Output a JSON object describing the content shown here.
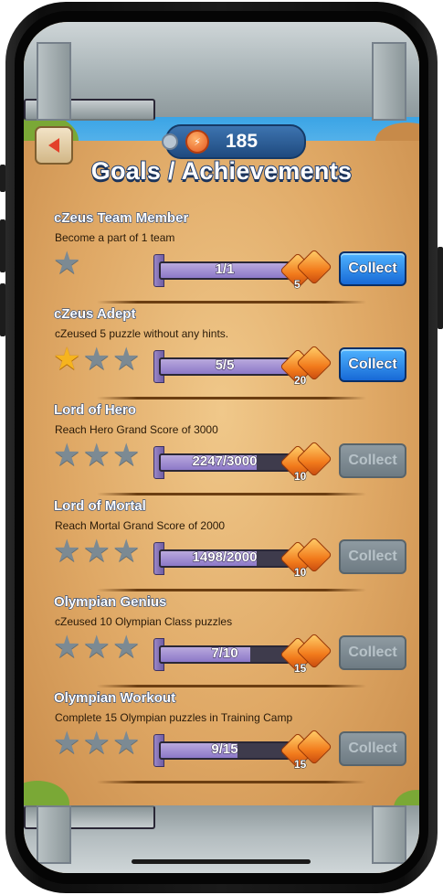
{
  "header": {
    "coin_count": "185",
    "title": "Goals / Achievements"
  },
  "achievements": [
    {
      "name": "cZeus Team Member",
      "description": "Become a part of 1 team",
      "stars_total": 1,
      "stars_earned": 0,
      "progress_text": "1/1",
      "progress": 1.0,
      "reward": "5",
      "collect_label": "Collect",
      "collect_enabled": true
    },
    {
      "name": "cZeus Adept",
      "description": "cZeused 5 puzzle without any hints.",
      "stars_total": 3,
      "stars_earned": 1,
      "progress_text": "5/5",
      "progress": 1.0,
      "reward": "20",
      "collect_label": "Collect",
      "collect_enabled": true
    },
    {
      "name": "Lord of Hero",
      "description": "Reach Hero Grand Score of 3000",
      "stars_total": 3,
      "stars_earned": 0,
      "progress_text": "2247/3000",
      "progress": 0.749,
      "reward": "10",
      "collect_label": "Collect",
      "collect_enabled": false
    },
    {
      "name": "Lord of Mortal",
      "description": "Reach Mortal Grand Score of 2000",
      "stars_total": 3,
      "stars_earned": 0,
      "progress_text": "1498/2000",
      "progress": 0.749,
      "reward": "10",
      "collect_label": "Collect",
      "collect_enabled": false
    },
    {
      "name": "Olympian Genius",
      "description": "cZeused 10 Olympian Class puzzles",
      "stars_total": 3,
      "stars_earned": 0,
      "progress_text": "7/10",
      "progress": 0.7,
      "reward": "15",
      "collect_label": "Collect",
      "collect_enabled": false
    },
    {
      "name": "Olympian Workout",
      "description": "Complete 15 Olympian puzzles in Training Camp",
      "stars_total": 3,
      "stars_earned": 0,
      "progress_text": "9/15",
      "progress": 0.6,
      "reward": "15",
      "collect_label": "Collect",
      "collect_enabled": false
    }
  ],
  "colors": {
    "collect_active": "#1769d6",
    "collect_disabled": "#7c8990",
    "star_gold": "#f6b41e",
    "star_empty": "#7c8a93"
  },
  "icons": {
    "back": "back-arrow-icon",
    "coin": "lightning-coin-icon",
    "reward": "lightning-gem-icon",
    "star": "star-icon"
  }
}
